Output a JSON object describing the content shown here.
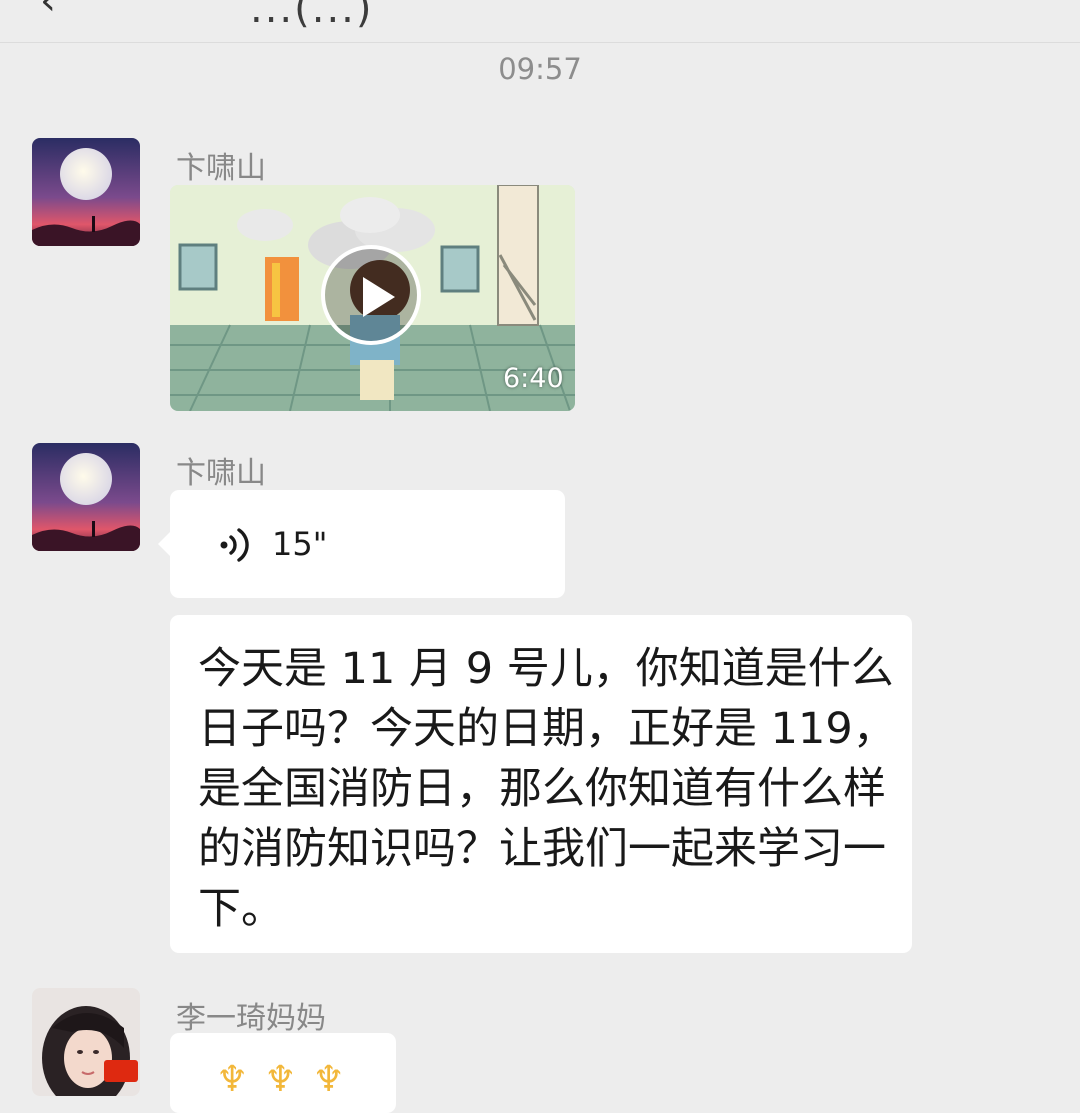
{
  "header": {
    "back_icon": "back-icon",
    "title_partial": "...(...)"
  },
  "timestamp": "09:57",
  "messages": [
    {
      "type": "video",
      "sender": "卞啸山",
      "avatar": "moon-night-avatar",
      "duration": "6:40",
      "play_icon": "play-icon"
    },
    {
      "type": "voice",
      "sender": "卞啸山",
      "avatar": "moon-night-avatar",
      "voice_icon": "voice-wave-icon",
      "duration": "15\""
    },
    {
      "type": "text",
      "sender": "卞啸山",
      "text": "今天是 11 月 9 号儿，你知道是什么日子吗？今天的日期，正好是 119，是全国消防日，那么你知道有什么样的消防知识吗？让我们一起来学习一下。"
    },
    {
      "type": "emoji",
      "sender": "李一琦妈妈",
      "avatar": "woman-portrait-avatar"
    }
  ],
  "colors": {
    "background": "#ededed",
    "bubble": "#ffffff",
    "sender_text": "#888888",
    "timestamp_text": "#8d8d8d"
  }
}
